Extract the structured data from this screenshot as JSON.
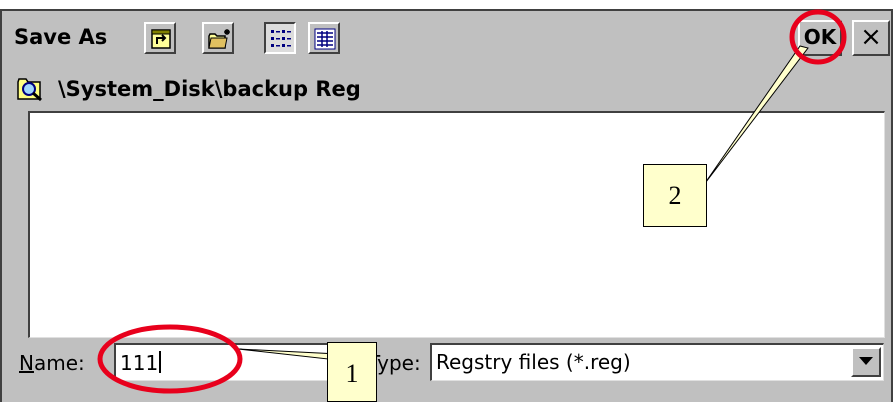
{
  "dialog": {
    "title": "Save As",
    "ok_label": "OK",
    "close_label": "×",
    "path": "\\System_Disk\\backup Reg"
  },
  "form": {
    "name_label_prefix": "N",
    "name_label_rest": "ame:",
    "name_value": "111",
    "type_label": "Type:",
    "type_value": "Regstry files (*.reg)"
  },
  "annotations": {
    "callout_1": "1",
    "callout_2": "2",
    "highlight_color": "#e8001c",
    "callout_color": "#ffffcc"
  },
  "icons": {
    "toolbar": [
      "up-folder-icon",
      "new-folder-icon",
      "list-view-icon",
      "details-view-icon"
    ],
    "path": "folder-search-icon",
    "dropdown": "chevron-down-icon"
  }
}
